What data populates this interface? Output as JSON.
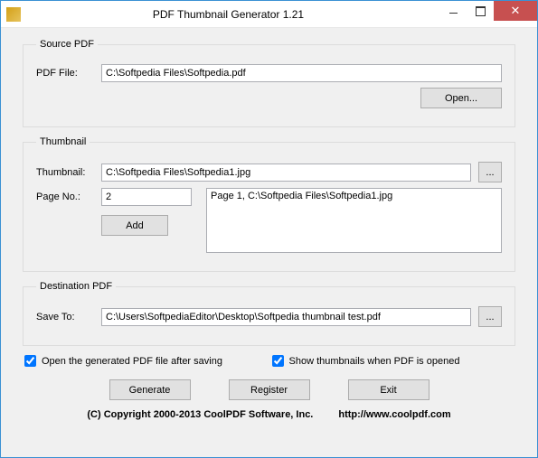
{
  "window": {
    "title": "PDF Thumbnail Generator 1.21"
  },
  "source": {
    "legend": "Source PDF",
    "label": "PDF File:",
    "value": "C:\\Softpedia Files\\Softpedia.pdf",
    "open": "Open..."
  },
  "thumbnail": {
    "legend": "Thumbnail",
    "label": "Thumbnail:",
    "value": "C:\\Softpedia Files\\Softpedia1.jpg",
    "browse": "...",
    "page_label": "Page No.:",
    "page_value": "2",
    "add": "Add",
    "list_item": "Page 1, C:\\Softpedia Files\\Softpedia1.jpg"
  },
  "destination": {
    "legend": "Destination PDF",
    "label": "Save To:",
    "value": "C:\\Users\\SoftpediaEditor\\Desktop\\Softpedia thumbnail test.pdf",
    "browse": "..."
  },
  "checks": {
    "open_after": "Open the generated PDF file after saving",
    "show_thumbs": "Show thumbnails when PDF is opened"
  },
  "buttons": {
    "generate": "Generate",
    "register": "Register",
    "exit": "Exit"
  },
  "footer": {
    "copyright": "(C) Copyright 2000-2013 CoolPDF Software, Inc.",
    "url": "http://www.coolpdf.com"
  }
}
